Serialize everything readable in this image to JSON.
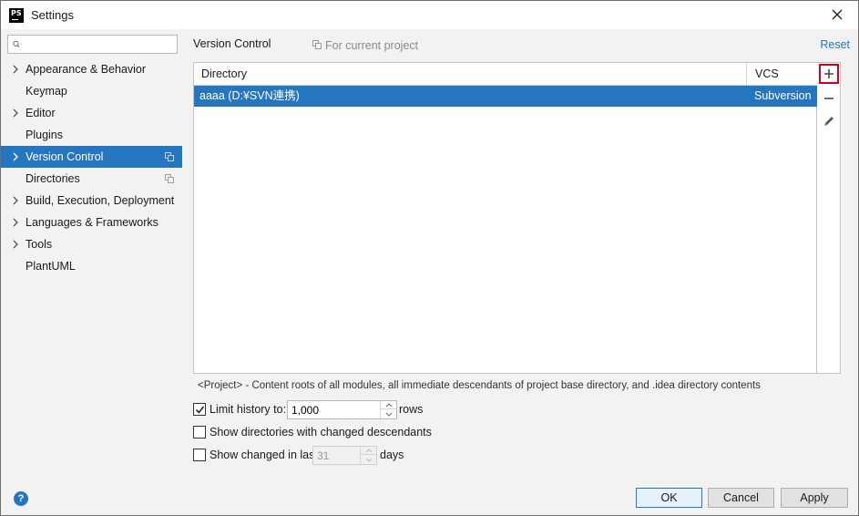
{
  "window": {
    "title": "Settings",
    "app_icon_label": "PS"
  },
  "sidebar": {
    "search": {
      "value": "",
      "placeholder": ""
    },
    "items": [
      {
        "label": "Appearance & Behavior",
        "expandable": true,
        "project_scoped": false,
        "selected": false
      },
      {
        "label": "Keymap",
        "expandable": false,
        "project_scoped": false,
        "selected": false
      },
      {
        "label": "Editor",
        "expandable": true,
        "project_scoped": false,
        "selected": false
      },
      {
        "label": "Plugins",
        "expandable": false,
        "project_scoped": false,
        "selected": false
      },
      {
        "label": "Version Control",
        "expandable": true,
        "project_scoped": true,
        "selected": true
      },
      {
        "label": "Directories",
        "expandable": false,
        "project_scoped": true,
        "selected": false
      },
      {
        "label": "Build, Execution, Deployment",
        "expandable": true,
        "project_scoped": false,
        "selected": false
      },
      {
        "label": "Languages & Frameworks",
        "expandable": true,
        "project_scoped": false,
        "selected": false
      },
      {
        "label": "Tools",
        "expandable": true,
        "project_scoped": false,
        "selected": false
      },
      {
        "label": "PlantUML",
        "expandable": false,
        "project_scoped": false,
        "selected": false
      }
    ]
  },
  "main": {
    "title": "Version Control",
    "scope_label": "For current project",
    "reset_label": "Reset",
    "table": {
      "columns": [
        "Directory",
        "VCS"
      ],
      "rows": [
        {
          "directory": "aaaa (D:¥SVN連携)",
          "vcs": "Subversion",
          "selected": true
        }
      ]
    },
    "toolbar": {
      "add_icon": "plus-icon",
      "remove_icon": "minus-icon",
      "edit_icon": "pencil-icon"
    },
    "info_text": "<Project> - Content roots of all modules, all immediate descendants of project base directory, and .idea directory contents",
    "options": {
      "limit_history": {
        "label": "Limit history to:",
        "checked": true,
        "value": "1,000",
        "suffix": "rows"
      },
      "show_dirs_changed": {
        "label": "Show directories with changed descendants",
        "checked": false
      },
      "show_changed_last": {
        "label": "Show changed in last",
        "checked": false,
        "value": "31",
        "suffix": "days",
        "disabled": true
      }
    }
  },
  "footer": {
    "help_label": "?",
    "ok_label": "OK",
    "cancel_label": "Cancel",
    "apply_label": "Apply"
  },
  "colors": {
    "accent": "#2675bf",
    "highlight_border": "#d0021b",
    "panel_bg": "#f2f2f2"
  }
}
